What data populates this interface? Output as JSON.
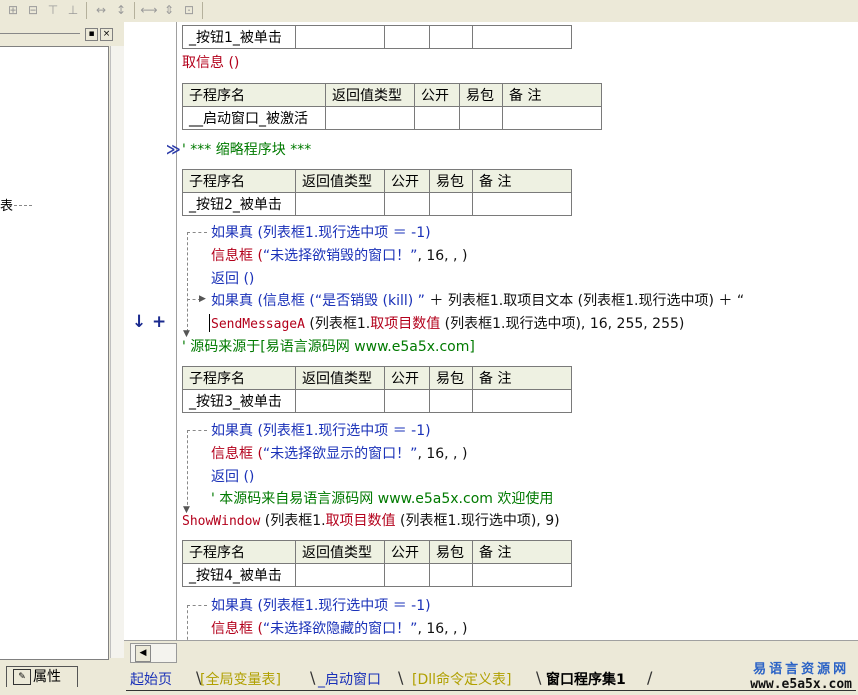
{
  "toolbar": {
    "icons": [
      "align-left-icon",
      "align-center-icon",
      "align-top-icon",
      "align-middle-icon",
      "hspace-icon",
      "vspace-icon",
      "same-width-icon",
      "same-height-icon",
      "same-size-icon"
    ]
  },
  "left_panel": {
    "pin_label": "▪",
    "close_label": "×",
    "fragment": "表",
    "properties_tab": "属性"
  },
  "code": {
    "row1_handler": "_按钮1_被单击",
    "call1": "取信息 ()",
    "table_headers": [
      "子程序名",
      "返回值类型",
      "公开",
      "易包",
      "备 注"
    ],
    "sub1_name": "__启动窗口_被激活",
    "collapsed": "' *** 缩略程序块 ***",
    "sub2_name": "_按钮2_被单击",
    "l1": "如果真 (列表框1.现行选中项 ＝ -1)",
    "l2_a": "信息框 (",
    "l2_b": "“未选择欲销毁的窗口！”",
    "l2_c": ", 16, , )",
    "l3": "返回 ()",
    "l4_a": "如果真 (信息框 (",
    "l4_b": "“是否销毁 (kill) ”",
    "l4_c": " ＋ 列表框1.取项目文本 (列表框1.现行选中项) ＋ “",
    "l5_a": "SendMessageA",
    "l5_b": " (列表框1.",
    "l5_c": "取项目数值",
    "l5_d": " (列表框1.现行选中项), 16, 255, 255)",
    "l6": "' 源码来源于[易语言源码网 www.e5a5x.com]",
    "sub3_name": "_按钮3_被单击",
    "m1": "如果真 (列表框1.现行选中项 ＝ -1)",
    "m2_a": "信息框 (",
    "m2_b": "“未选择欲显示的窗口！”",
    "m2_c": ", 16, , )",
    "m3": "返回 ()",
    "m4": "' 本源码来自易语言源码网 www.e5a5x.com  欢迎使用",
    "m5_a": "ShowWindow",
    "m5_b": " (列表框1.",
    "m5_c": "取项目数值",
    "m5_d": " (列表框1.现行选中项), 9)",
    "sub4_name": "_按钮4_被单击",
    "n1": "如果真 (列表框1.现行选中项 ＝ -1)",
    "n2_a": "信息框 (",
    "n2_b": "“未选择欲隐藏的窗口！”",
    "n2_c": ", 16, , )"
  },
  "gutter": {
    "arrow": "↓",
    "plus": "+",
    "collapse_marker": "≫"
  },
  "tabs": [
    "起始页",
    "[全局变量表]",
    "_启动窗口",
    "[Dll命令定义表]",
    "窗口程序集1"
  ],
  "active_tab": "窗口程序集1",
  "scroll_left": "◀",
  "watermark": {
    "line1": "易语言资源网",
    "line2": "www.e5a5x.com"
  },
  "colors": {
    "keyword_red": "#b3001b",
    "comment_green": "#007a00",
    "string_blue": "#1a31b8"
  }
}
